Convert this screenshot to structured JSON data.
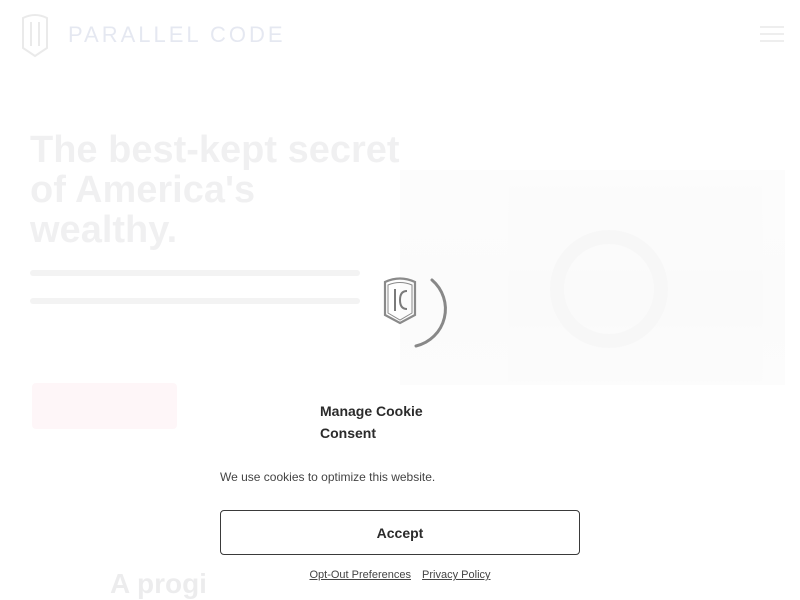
{
  "header": {
    "brand_name": "PARALLEL CODE",
    "logo_icon": "shield-logo-icon",
    "menu_icon": "hamburger-menu-icon"
  },
  "hero": {
    "title": "The best-kept secret of America's wealthy."
  },
  "section": {
    "heading": "A progi"
  },
  "loader": {
    "icon": "spinner-icon",
    "logo_icon": "shield-logo-icon",
    "accent_color": "#888888"
  },
  "consent": {
    "title": "Manage Cookie Consent",
    "message": "We use cookies to optimize this website.",
    "accept_label": "Accept",
    "opt_out_label": "Opt-Out Preferences",
    "privacy_label": "Privacy Policy"
  }
}
